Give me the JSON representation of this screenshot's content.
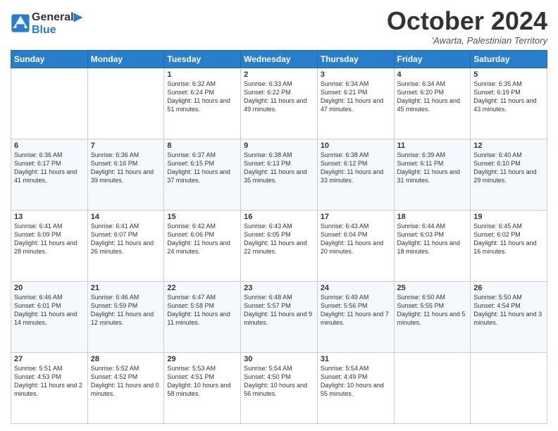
{
  "header": {
    "logo_line1": "General",
    "logo_line2": "Blue",
    "month": "October 2024",
    "location": "'Awarta, Palestinian Territory"
  },
  "days_of_week": [
    "Sunday",
    "Monday",
    "Tuesday",
    "Wednesday",
    "Thursday",
    "Friday",
    "Saturday"
  ],
  "weeks": [
    [
      {
        "day": "",
        "content": ""
      },
      {
        "day": "",
        "content": ""
      },
      {
        "day": "1",
        "content": "Sunrise: 6:32 AM\nSunset: 6:24 PM\nDaylight: 11 hours and 51 minutes."
      },
      {
        "day": "2",
        "content": "Sunrise: 6:33 AM\nSunset: 6:22 PM\nDaylight: 11 hours and 49 minutes."
      },
      {
        "day": "3",
        "content": "Sunrise: 6:34 AM\nSunset: 6:21 PM\nDaylight: 11 hours and 47 minutes."
      },
      {
        "day": "4",
        "content": "Sunrise: 6:34 AM\nSunset: 6:20 PM\nDaylight: 11 hours and 45 minutes."
      },
      {
        "day": "5",
        "content": "Sunrise: 6:35 AM\nSunset: 6:19 PM\nDaylight: 11 hours and 43 minutes."
      }
    ],
    [
      {
        "day": "6",
        "content": "Sunrise: 6:36 AM\nSunset: 6:17 PM\nDaylight: 11 hours and 41 minutes."
      },
      {
        "day": "7",
        "content": "Sunrise: 6:36 AM\nSunset: 6:16 PM\nDaylight: 11 hours and 39 minutes."
      },
      {
        "day": "8",
        "content": "Sunrise: 6:37 AM\nSunset: 6:15 PM\nDaylight: 11 hours and 37 minutes."
      },
      {
        "day": "9",
        "content": "Sunrise: 6:38 AM\nSunset: 6:13 PM\nDaylight: 11 hours and 35 minutes."
      },
      {
        "day": "10",
        "content": "Sunrise: 6:38 AM\nSunset: 6:12 PM\nDaylight: 11 hours and 33 minutes."
      },
      {
        "day": "11",
        "content": "Sunrise: 6:39 AM\nSunset: 6:11 PM\nDaylight: 11 hours and 31 minutes."
      },
      {
        "day": "12",
        "content": "Sunrise: 6:40 AM\nSunset: 6:10 PM\nDaylight: 11 hours and 29 minutes."
      }
    ],
    [
      {
        "day": "13",
        "content": "Sunrise: 6:41 AM\nSunset: 6:09 PM\nDaylight: 11 hours and 28 minutes."
      },
      {
        "day": "14",
        "content": "Sunrise: 6:41 AM\nSunset: 6:07 PM\nDaylight: 11 hours and 26 minutes."
      },
      {
        "day": "15",
        "content": "Sunrise: 6:42 AM\nSunset: 6:06 PM\nDaylight: 11 hours and 24 minutes."
      },
      {
        "day": "16",
        "content": "Sunrise: 6:43 AM\nSunset: 6:05 PM\nDaylight: 11 hours and 22 minutes."
      },
      {
        "day": "17",
        "content": "Sunrise: 6:43 AM\nSunset: 6:04 PM\nDaylight: 11 hours and 20 minutes."
      },
      {
        "day": "18",
        "content": "Sunrise: 6:44 AM\nSunset: 6:03 PM\nDaylight: 11 hours and 18 minutes."
      },
      {
        "day": "19",
        "content": "Sunrise: 6:45 AM\nSunset: 6:02 PM\nDaylight: 11 hours and 16 minutes."
      }
    ],
    [
      {
        "day": "20",
        "content": "Sunrise: 6:46 AM\nSunset: 6:01 PM\nDaylight: 11 hours and 14 minutes."
      },
      {
        "day": "21",
        "content": "Sunrise: 6:46 AM\nSunset: 5:59 PM\nDaylight: 11 hours and 12 minutes."
      },
      {
        "day": "22",
        "content": "Sunrise: 6:47 AM\nSunset: 5:58 PM\nDaylight: 11 hours and 11 minutes."
      },
      {
        "day": "23",
        "content": "Sunrise: 6:48 AM\nSunset: 5:57 PM\nDaylight: 11 hours and 9 minutes."
      },
      {
        "day": "24",
        "content": "Sunrise: 6:49 AM\nSunset: 5:56 PM\nDaylight: 11 hours and 7 minutes."
      },
      {
        "day": "25",
        "content": "Sunrise: 6:50 AM\nSunset: 5:55 PM\nDaylight: 11 hours and 5 minutes."
      },
      {
        "day": "26",
        "content": "Sunrise: 5:50 AM\nSunset: 4:54 PM\nDaylight: 11 hours and 3 minutes."
      }
    ],
    [
      {
        "day": "27",
        "content": "Sunrise: 5:51 AM\nSunset: 4:53 PM\nDaylight: 11 hours and 2 minutes."
      },
      {
        "day": "28",
        "content": "Sunrise: 5:52 AM\nSunset: 4:52 PM\nDaylight: 11 hours and 0 minutes."
      },
      {
        "day": "29",
        "content": "Sunrise: 5:53 AM\nSunset: 4:51 PM\nDaylight: 10 hours and 58 minutes."
      },
      {
        "day": "30",
        "content": "Sunrise: 5:54 AM\nSunset: 4:50 PM\nDaylight: 10 hours and 56 minutes."
      },
      {
        "day": "31",
        "content": "Sunrise: 5:54 AM\nSunset: 4:49 PM\nDaylight: 10 hours and 55 minutes."
      },
      {
        "day": "",
        "content": ""
      },
      {
        "day": "",
        "content": ""
      }
    ]
  ]
}
